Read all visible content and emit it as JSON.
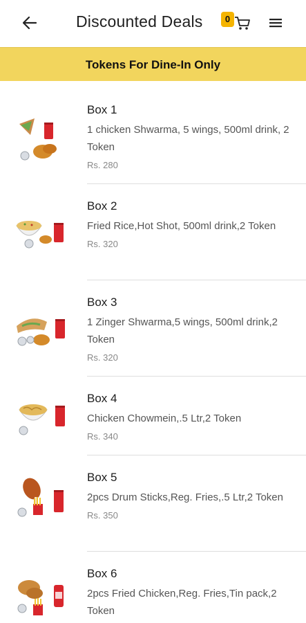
{
  "header": {
    "title": "Discounted Deals",
    "cart_count": "0",
    "icons": {
      "back": "back-arrow-icon",
      "cart": "cart-icon",
      "menu": "hamburger-menu-icon"
    }
  },
  "banner": {
    "text": "Tokens For Dine-In Only"
  },
  "deals": [
    {
      "name": "Box 1",
      "description": "1 chicken Shwarma, 5 wings, 500ml drink, 2 Token",
      "price": "Rs. 280"
    },
    {
      "name": "Box 2",
      "description": "Fried Rice,Hot Shot, 500ml drink,2 Token",
      "price": "Rs. 320"
    },
    {
      "name": "Box 3",
      "description": "1 Zinger Shwarma,5 wings, 500ml drink,2 Token",
      "price": "Rs. 320"
    },
    {
      "name": "Box 4",
      "description": "Chicken Chowmein,.5 Ltr,2 Token",
      "price": "Rs. 340"
    },
    {
      "name": "Box 5",
      "description": "2pcs Drum Sticks,Reg. Fries,.5 Ltr,2 Token",
      "price": "Rs. 350"
    },
    {
      "name": "Box 6",
      "description": "2pcs Fried Chicken,Reg. Fries,Tin pack,2 Token",
      "price": ""
    }
  ],
  "colors": {
    "banner": "#f2d55d",
    "badge": "#f5b400",
    "drink_red": "#d8262c"
  }
}
